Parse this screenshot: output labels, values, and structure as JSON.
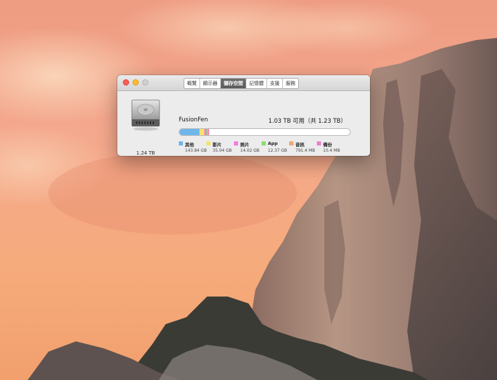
{
  "window": {
    "tabs": [
      {
        "label": "概覽",
        "active": false
      },
      {
        "label": "顯示器",
        "active": false
      },
      {
        "label": "儲存空間",
        "active": true
      },
      {
        "label": "記憶體",
        "active": false
      },
      {
        "label": "支援",
        "active": false
      },
      {
        "label": "服務",
        "active": false
      }
    ]
  },
  "drive": {
    "icon": "hard-drive-icon",
    "size": "1.24 TB",
    "type": "Fusion Drive"
  },
  "volume": {
    "name": "FusionFen",
    "free_text": "1.03 TB 可用（共 1.23 TB）",
    "usage": [
      {
        "label": "其他",
        "value": "143.84 GB",
        "gb": 143.84,
        "color": "#6fb7ea"
      },
      {
        "label": "影片",
        "value": "35.04 GB",
        "gb": 35.04,
        "color": "#f5e26a"
      },
      {
        "label": "照片",
        "value": "14.02 GB",
        "gb": 14.02,
        "color": "#f17ce0"
      },
      {
        "label": "App",
        "value": "12.37 GB",
        "gb": 12.37,
        "color": "#8ddc6f"
      },
      {
        "label": "音訊",
        "value": "791.4 MB",
        "gb": 0.79,
        "color": "#f0a578"
      },
      {
        "label": "備份",
        "value": "10.4 MB",
        "gb": 0.01,
        "color": "#f07fcf"
      }
    ],
    "capacity_gb": 1230
  }
}
